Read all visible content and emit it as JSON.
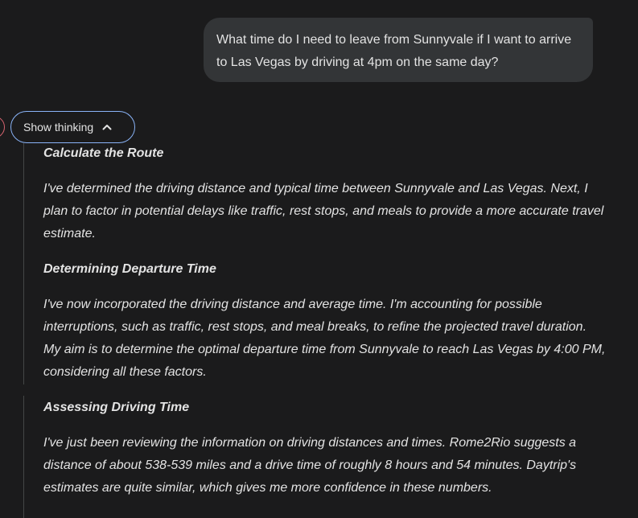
{
  "user_message": {
    "text": "What time do I need to leave from Sunnyvale if I want to arrive to Las Vegas by driving at 4pm on the same day?"
  },
  "thinking_toggle": {
    "label": "Show thinking",
    "icon": "chevron-up-icon"
  },
  "thoughts": [
    {
      "heading": "Calculate the Route",
      "body": "I've determined the driving distance and typical time between Sunnyvale and Las Vegas. Next, I plan to factor in potential delays like traffic, rest stops, and meals to provide a more accurate travel estimate."
    },
    {
      "heading": "Determining Departure Time",
      "body": "I've now incorporated the driving distance and average time. I'm accounting for possible interruptions, such as traffic, rest stops, and meal breaks, to refine the projected travel duration. My aim is to determine the optimal departure time from Sunnyvale to reach Las Vegas by 4:00 PM, considering all these factors."
    },
    {
      "heading": "Assessing Driving Time",
      "body": "I've just been reviewing the information on driving distances and times. Rome2Rio suggests a distance of about 538-539 miles and a drive time of roughly 8 hours and 54 minutes. Daytrip's estimates are quite similar, which gives me more confidence in these numbers."
    }
  ],
  "colors": {
    "background": "#1b1b1c",
    "user_bubble": "#333537",
    "toggle_border": "#8ab4f8",
    "avatar_ring": "#d96570"
  }
}
